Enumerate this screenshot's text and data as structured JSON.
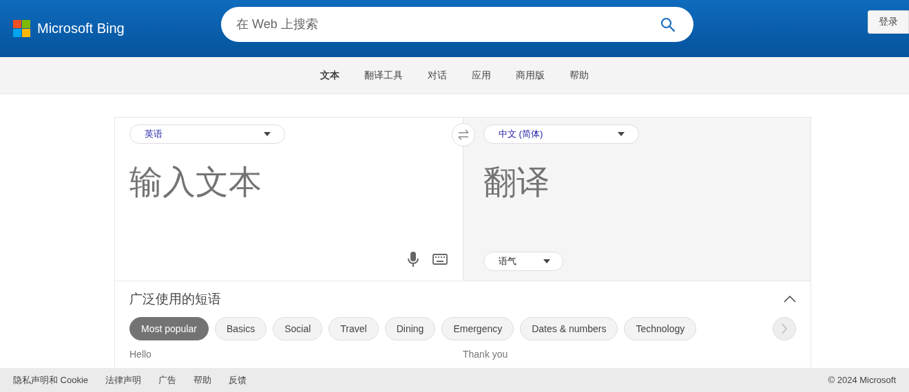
{
  "header": {
    "logo_text": "Microsoft Bing",
    "search": {
      "placeholder": "在 Web 上搜索"
    },
    "sign_in": "登录"
  },
  "nav": [
    {
      "label": "文本",
      "selected": true
    },
    {
      "label": "翻译工具",
      "selected": false
    },
    {
      "label": "对话",
      "selected": false
    },
    {
      "label": "应用",
      "selected": false
    },
    {
      "label": "商用版",
      "selected": false
    },
    {
      "label": "帮助",
      "selected": false
    }
  ],
  "translator": {
    "source_language": "英语",
    "target_language": "中文 (简体)",
    "input": {
      "placeholder": "输入文本"
    },
    "output_placeholder": "翻译",
    "tone": "语气"
  },
  "phrases": {
    "title": "广泛使用的短语",
    "expanded": true,
    "categories": [
      {
        "label": "Most popular",
        "selected": true
      },
      {
        "label": "Basics",
        "selected": false
      },
      {
        "label": "Social",
        "selected": false
      },
      {
        "label": "Travel",
        "selected": false
      },
      {
        "label": "Dining",
        "selected": false
      },
      {
        "label": "Emergency",
        "selected": false
      },
      {
        "label": "Dates & numbers",
        "selected": false
      },
      {
        "label": "Technology",
        "selected": false
      }
    ],
    "items": [
      "Hello",
      "Thank you"
    ]
  },
  "footer": {
    "links": [
      "隐私声明和 Cookie",
      "法律声明",
      "广告",
      "帮助",
      "反馈"
    ],
    "copyright": "© 2024 Microsoft"
  }
}
